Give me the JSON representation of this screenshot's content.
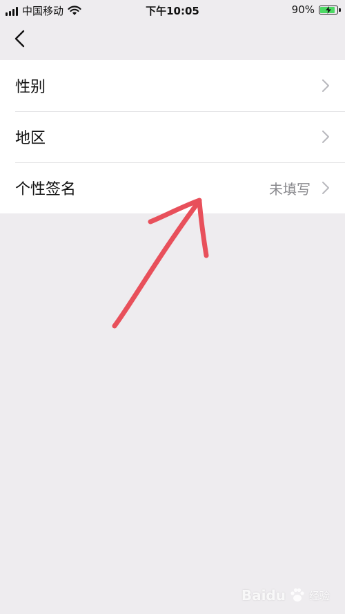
{
  "status_bar": {
    "carrier": "中国移动",
    "time": "下午10:05",
    "battery_percent": "90%",
    "battery_level": 0.9,
    "icons": [
      "signal-icon",
      "wifi-icon",
      "battery-icon"
    ]
  },
  "nav": {
    "back_icon": "chevron-left-icon"
  },
  "settings": {
    "items": [
      {
        "label": "性别",
        "value": ""
      },
      {
        "label": "地区",
        "value": ""
      },
      {
        "label": "个性签名",
        "value": "未填写"
      }
    ]
  },
  "colors": {
    "background": "#eeecef",
    "annotation": "#e8505b",
    "battery_fill": "#4cd964"
  },
  "watermark": {
    "text": "Baidu",
    "sub": "经验"
  }
}
